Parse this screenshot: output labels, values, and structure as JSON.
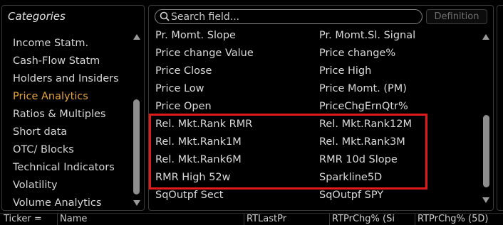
{
  "categories_panel": {
    "title": "Categories",
    "items": [
      {
        "label": "Income Statm."
      },
      {
        "label": "Cash-Flow Statm"
      },
      {
        "label": "Holders and Insiders"
      },
      {
        "label": "Price Analytics",
        "active": true
      },
      {
        "label": "Ratios & Multiples"
      },
      {
        "label": "Short data"
      },
      {
        "label": "OTC/ Blocks"
      },
      {
        "label": "Technical Indicators"
      },
      {
        "label": "Volatility"
      },
      {
        "label": "Volume Analytics"
      }
    ]
  },
  "fields_panel": {
    "search_placeholder": "Search field...",
    "definition_label": "Definition",
    "rows": [
      [
        "Pr. Momt. Slope",
        "Pr. Momt.Sl. Signal"
      ],
      [
        "Price change Value",
        "Price change%"
      ],
      [
        "Price Close",
        "Price High"
      ],
      [
        "Price Low",
        "Price Momt. (PM)"
      ],
      [
        "Price Open",
        "PriceChgErnQtr%"
      ],
      [
        "Rel. Mkt.Rank RMR",
        "Rel. Mkt.Rank12M"
      ],
      [
        "Rel. Mkt.Rank1M",
        "Rel. Mkt.Rank3M"
      ],
      [
        "Rel. Mkt.Rank6M",
        "RMR 10d Slope"
      ],
      [
        "RMR High 52w",
        "Sparkline5D"
      ],
      [
        "SqOutpf Sect",
        "SqOutpf SPY"
      ]
    ]
  },
  "bottom_columns": [
    "Ticker =",
    "Name",
    "RTLastPr",
    "RTPrChg% (Si",
    "RTPrChg% (5D)"
  ],
  "colors": {
    "active_category": "#e8a33d",
    "highlight_box": "#e01b1b",
    "background": "#000000"
  }
}
